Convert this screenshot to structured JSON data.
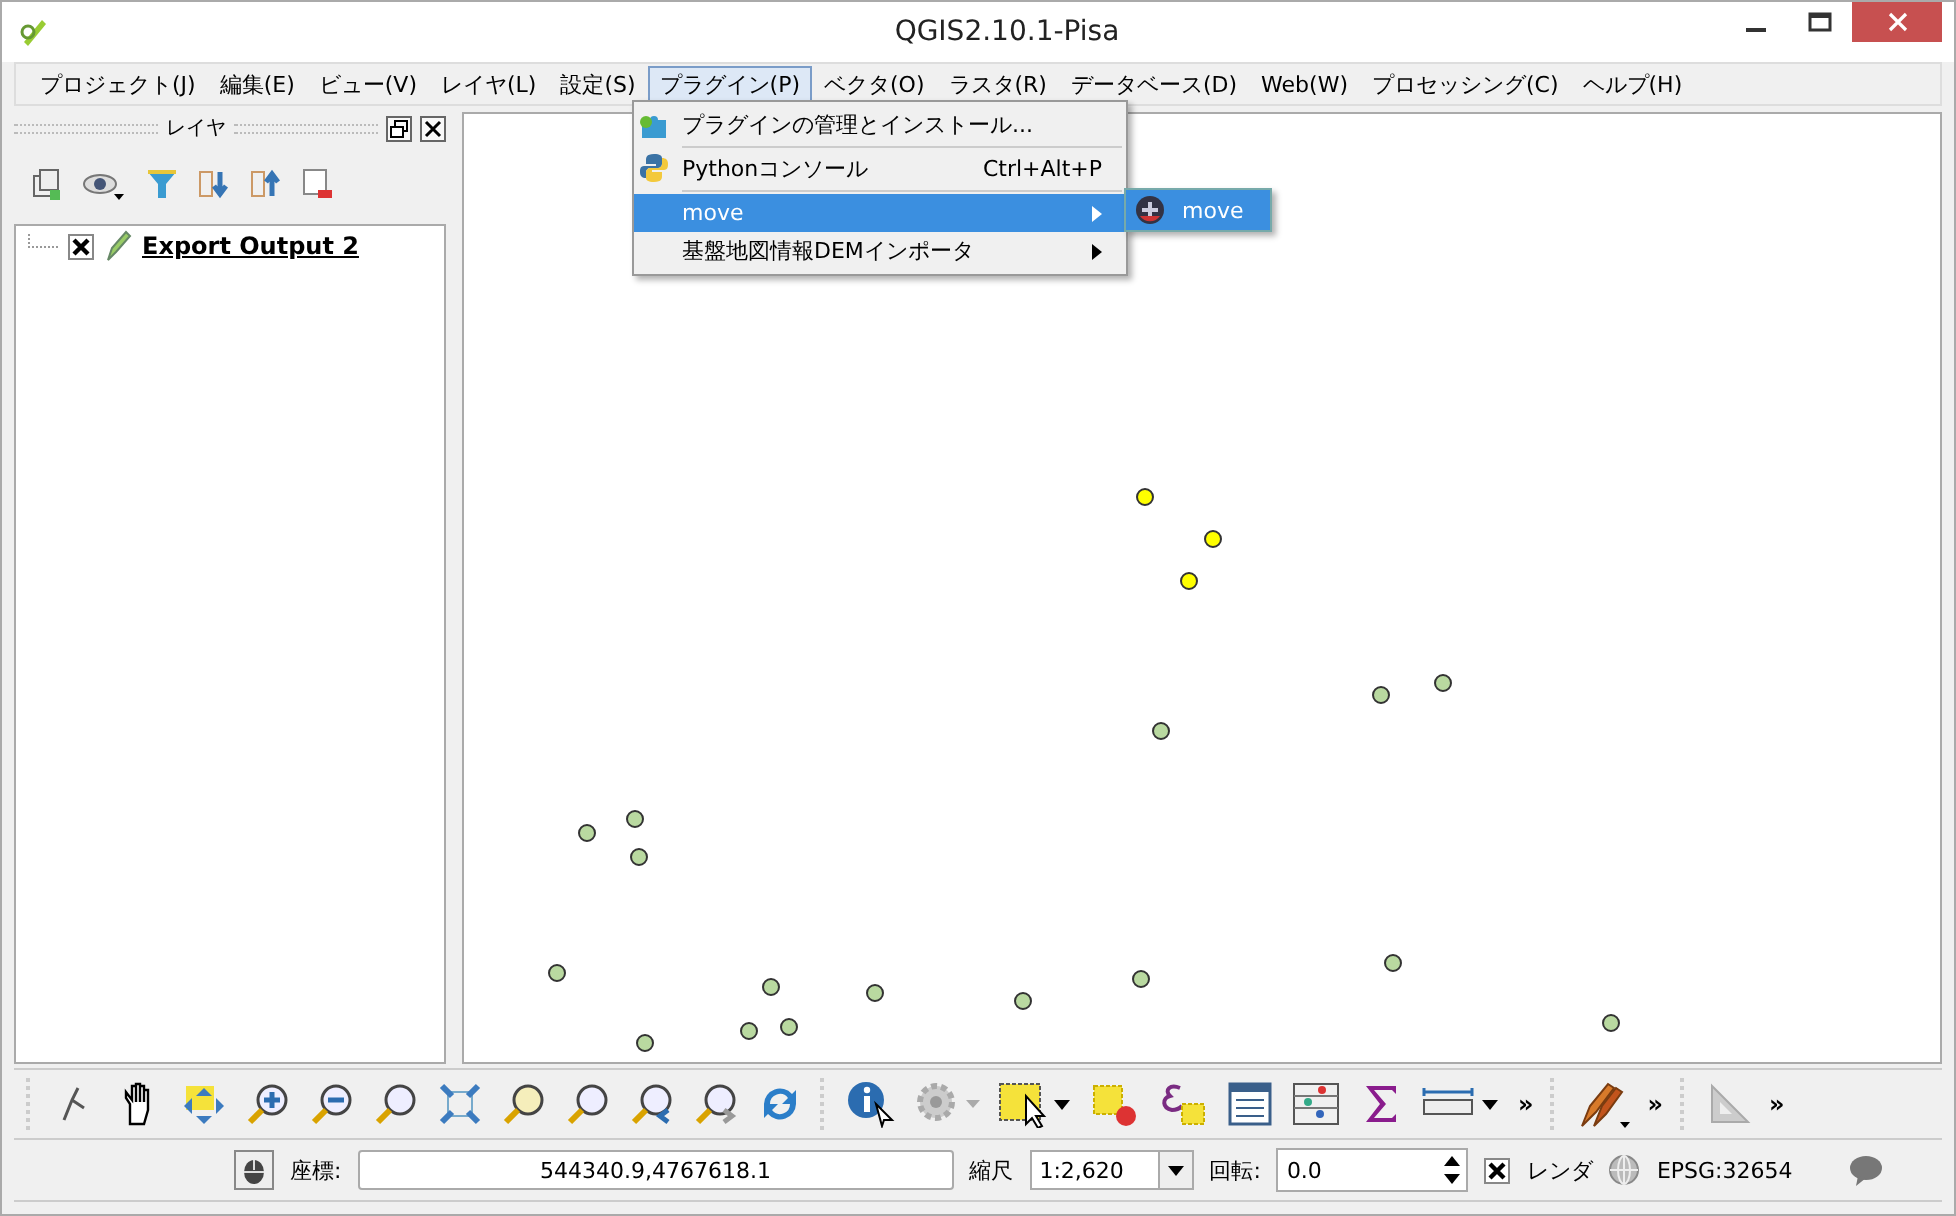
{
  "window": {
    "title": "QGIS2.10.1-Pisa"
  },
  "menu_bar": [
    {
      "label": "プロジェクト(J)",
      "selected": false
    },
    {
      "label": "編集(E)",
      "selected": false
    },
    {
      "label": "ビュー(V)",
      "selected": false
    },
    {
      "label": "レイヤ(L)",
      "selected": false
    },
    {
      "label": "設定(S)",
      "selected": false
    },
    {
      "label": "プラグイン(P)",
      "selected": true
    },
    {
      "label": "ベクタ(O)",
      "selected": false
    },
    {
      "label": "ラスタ(R)",
      "selected": false
    },
    {
      "label": "データベース(D)",
      "selected": false
    },
    {
      "label": "Web(W)",
      "selected": false
    },
    {
      "label": "プロセッシング(C)",
      "selected": false
    },
    {
      "label": "ヘルプ(H)",
      "selected": false
    }
  ],
  "plugin_menu": [
    {
      "kind": "item",
      "label": "プラグインの管理とインストール...",
      "selected": false,
      "submenu": false
    },
    {
      "kind": "separator"
    },
    {
      "kind": "item",
      "label": "Pythonコンソール",
      "shortcut": "Ctrl+Alt+P",
      "selected": false,
      "submenu": false
    },
    {
      "kind": "separator"
    },
    {
      "kind": "item",
      "label": "move",
      "selected": true,
      "submenu": true
    },
    {
      "kind": "item",
      "label": "基盤地図情報DEMインポータ",
      "selected": false,
      "submenu": true
    }
  ],
  "submenu": [
    {
      "label": "move",
      "selected": true
    }
  ],
  "layers_panel": {
    "title": "レイヤ",
    "layers": [
      {
        "name": "Export Output 2",
        "visible": true
      }
    ]
  },
  "map": {
    "points": [
      {
        "selected": true
      },
      {
        "selected": true
      },
      {
        "selected": true
      },
      {
        "selected": false
      },
      {
        "selected": false
      },
      {
        "selected": false
      },
      {
        "selected": false
      },
      {
        "selected": false
      },
      {
        "selected": false
      },
      {
        "selected": false
      },
      {
        "selected": false
      },
      {
        "selected": false
      },
      {
        "selected": false
      },
      {
        "selected": false
      },
      {
        "selected": false
      },
      {
        "selected": false
      },
      {
        "selected": false
      },
      {
        "selected": false
      },
      {
        "selected": false
      }
    ]
  },
  "toolbar": {
    "overflow": [
      "»",
      "»",
      "»"
    ]
  },
  "status_bar": {
    "coordinate_label": "座標:",
    "coordinate": "544340.9,4767618.1",
    "scale_label": "縮尺",
    "scale": "1:2,620",
    "rotation_label": "回転:",
    "rotation": "0.0",
    "render_label": "レンダ",
    "render": true,
    "crs": "EPSG:32654"
  }
}
